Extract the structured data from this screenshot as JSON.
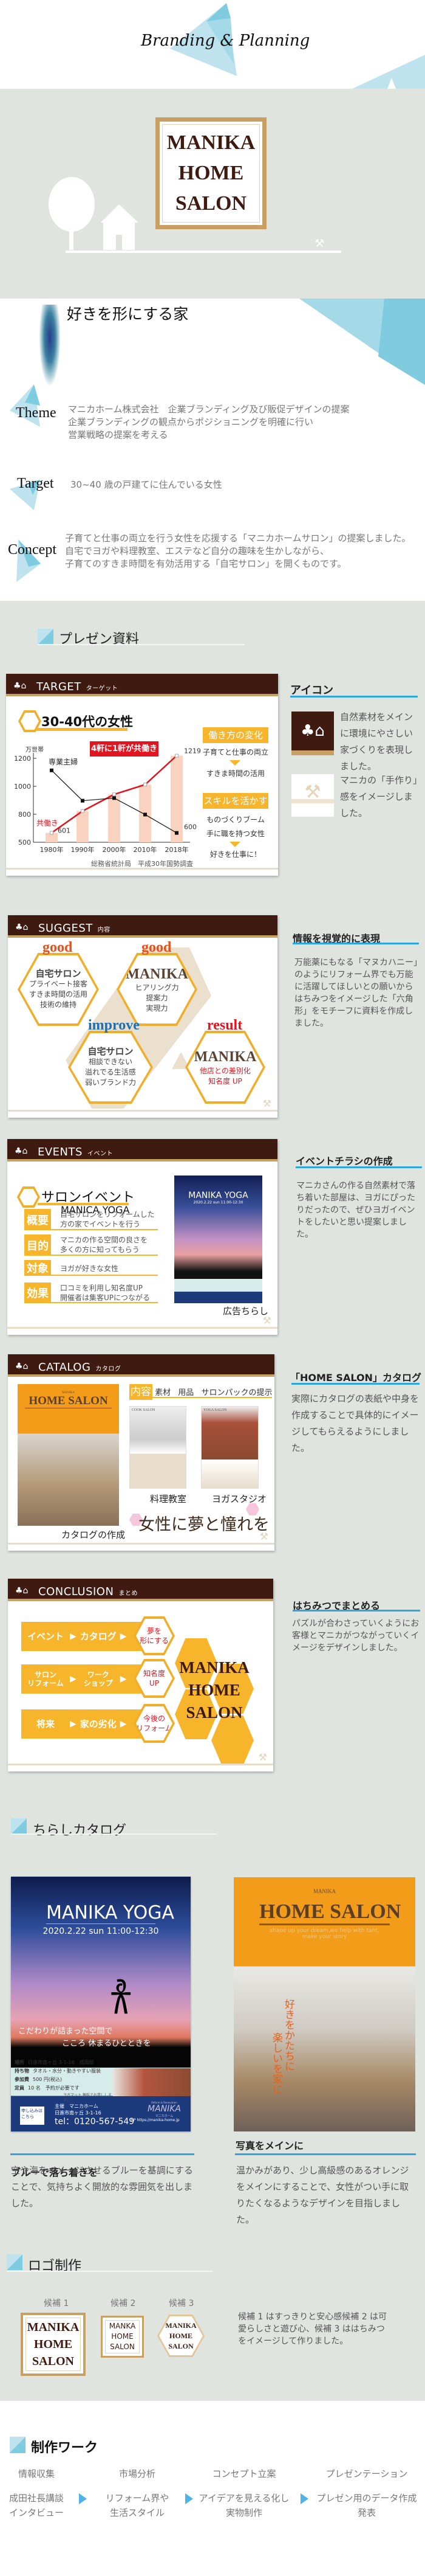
{
  "header": {
    "script_logo": "Branding & Planning"
  },
  "hero": {
    "logo_lines": [
      "MANIKA",
      "HOME",
      "SALON"
    ]
  },
  "intro": {
    "title": "好きを形にする家",
    "theme": {
      "label": "Theme",
      "lines": [
        "マニカホーム株式会社　企業ブランディング及び販促デザインの提案",
        "企業ブランディングの観点からポジショニングを明確に行い",
        "営業戦略の提案を考える"
      ]
    },
    "target": {
      "label": "Target",
      "lines": [
        "30~40 歳の戸建てに住んでいる女性"
      ]
    },
    "concept": {
      "label": "Concept",
      "lines": [
        "子育てと仕事の両立を行う女性を応援する「マニカホームサロン」の提案しました。",
        "自宅でヨガや料理教室、エステなど自分の趣味を生かしながら、",
        "子育てのすきま時間を有効活用する「自宅サロン」を開くものです。"
      ]
    }
  },
  "presentation": {
    "heading": "プレゼン資料",
    "slides": [
      {
        "title": "TARGET",
        "sub": "ターゲット",
        "headline": "30-40代の女性",
        "badge": "4軒に1軒が共働き",
        "box1": "働き方の変化",
        "box1_lines": [
          "子育てと仕事の両立",
          "すきま時間の活用"
        ],
        "box2": "スキルを活かす",
        "box2_lines": [
          "ものづくりブーム",
          "手に職を持つ女性",
          "好きを仕事に！"
        ],
        "source": "総務省統計局　平成30年国勢調査"
      },
      {
        "title": "SUGGEST",
        "sub": "内容",
        "hexes": [
          {
            "tag": "good",
            "title": "自宅サロン",
            "lines": [
              "プライベート接客",
              "すきま時間の活用",
              "技術の維持"
            ]
          },
          {
            "tag": "good",
            "title": "MANIKA",
            "lines": [
              "ヒアリング力",
              "提案力",
              "実現力"
            ]
          },
          {
            "tag": "improve",
            "title": "自宅サロン",
            "lines": [
              "相談できない",
              "溢れでる生活感",
              "弱いブランド力"
            ]
          },
          {
            "tag": "result",
            "title": "MANIKA",
            "lines": [
              "他店との差別化",
              "知名度 UP"
            ]
          }
        ]
      },
      {
        "title": "EVENTS",
        "sub": "イベント",
        "headline": "サロンイベント",
        "subhead": "MANICA YOGA",
        "rows": [
          {
            "label": "概要",
            "text": [
              "自宅サロンをリフォームした",
              "方の家でイベントを行う"
            ]
          },
          {
            "label": "目的",
            "text": [
              "マニカの作る空間の良さを",
              "多くの方に知ってもらう"
            ]
          },
          {
            "label": "対象",
            "text": [
              "ヨガが好きな女性"
            ]
          },
          {
            "label": "効果",
            "text": [
              "口コミを利用し知名度UP",
              "開催者は集客UPにつながる"
            ]
          }
        ],
        "poster_title": "MANIKA YOGA",
        "poster_date": "2020.2.22 sun  11:00-12:30",
        "poster_caption": "広告ちらし"
      },
      {
        "title": "CATALOG",
        "sub": "カタログ",
        "cover_brand": "MANIKA",
        "cover_title": "HOME SALON",
        "tabs": [
          "内容",
          "素材",
          "用品",
          "サロンパックの提示"
        ],
        "cook_label": "COOK SALON",
        "yoga_label": "YOGA SALON",
        "cook": "料理教室",
        "yoga": "ヨガスタジオ",
        "cover_caption": "カタログの作成",
        "slogan": "女性に夢と憧れを"
      },
      {
        "title": "CONCLUSION",
        "sub": "まとめ",
        "bars": [
          {
            "a": "イベント",
            "b": "カタログ",
            "hex": [
              "夢を",
              "形にする"
            ]
          },
          {
            "a": "サロン\nリフォーム",
            "b": "ワーク\nショップ",
            "hex": [
              "知名度",
              "UP"
            ]
          },
          {
            "a": "将来",
            "b": "家の劣化",
            "hex": [
              "今後の",
              "リフォーム"
            ]
          }
        ],
        "logo_lines": [
          "MANIKA",
          "HOME",
          "SALON"
        ]
      }
    ],
    "notes": [
      {
        "heading": "アイコン",
        "items": [
          {
            "icon": "tree-house-icon",
            "text": "自然素材をメインに環境にやさしい家づくりを表現しました。"
          },
          {
            "icon": "tools-icon",
            "text": "マニカの「手作り」感をイメージしました。"
          }
        ]
      },
      {
        "heading": "情報を視覚的に表現",
        "text": "万能薬にもなる「マヌカハニー」のようにリフォーム界でも万能に活躍してほしいとの願いからはちみつをイメージした「六角形」をモチーフに資料を作成しました。"
      },
      {
        "heading": "イベントチラシの作成",
        "text": "マニカさんの作る自然素材で落ち着いた部屋は、ヨガにぴったりだったので、ぜひヨガイベントをしたいと思い提案しました。"
      },
      {
        "heading": "「HOME SALON」カタログ",
        "text": "実際にカタログの表紙や中身を作成することで具体的にイメージしてもらえるようにしました。"
      },
      {
        "heading": "はちみつでまとめる",
        "text": "パズルが合わさっていくようにお客様とマニカがつながっていくイメージをデザインしました。"
      }
    ]
  },
  "chart_data": {
    "type": "bar+line",
    "title": "30-40代の女性",
    "ylabel": "万世帯",
    "categories": [
      "1980年",
      "1990年",
      "2000年",
      "2010年",
      "2018年"
    ],
    "yticks": [
      500,
      800,
      1000,
      1200
    ],
    "ylim": [
      500,
      1200
    ],
    "series": [
      {
        "name": "共働き",
        "type": "bar+line",
        "color": "#e0151f",
        "values": [
          601,
          823,
          942,
          1012,
          1219
        ]
      },
      {
        "name": "専業主婦",
        "type": "line",
        "color": "#111111",
        "values": [
          1114,
          897,
          916,
          797,
          600
        ]
      }
    ],
    "data_labels": {
      "共働き": {
        "0": "601",
        "4": "1219"
      },
      "専業主婦": {
        "4": "600"
      }
    },
    "source": "総務省統計局　平成30年国勢調査"
  },
  "flyers": {
    "heading": "ちらしカタログ",
    "yoga": {
      "title": "MANIKA YOGA",
      "date": "2020.2.22 sun  11:00-12:30",
      "tagline": [
        "こだわりが詰まった空間で",
        "こころ 休まるひとときを"
      ],
      "info": [
        {
          "k": "場所",
          "v": "日進市南ヶ丘 3-1-16　成田邸"
        },
        {
          "k": "持ち物",
          "v": "タオル・水分・動きやすい服装"
        },
        {
          "k": "参加費",
          "v": "500 円(税込)"
        },
        {
          "k": "定員",
          "v": "10 名　予約が必要です"
        }
      ],
      "mat_note": "ヨガマット 無料でお貸しします♪",
      "apply": "申し込みはこちら",
      "host": "主催　マニカホーム",
      "address": "日進市南ヶ丘 3-1-16",
      "tel": "tel：0120-567-549",
      "hp": "HP https://manika-home.jp",
      "brand_small": "Reform & Renovation",
      "brand": "MANIKA",
      "brand_jp": "マニカホーム",
      "caption": "ブルーで落ち着きを",
      "text": "空や海をイメージさせるブルーを基調にすることで、気持ちよく開放的な雰囲気を出しました。"
    },
    "salon": {
      "brand": "MANIKA",
      "title": "HOME SALON",
      "tag": [
        "shape up your dream,we help with taht,",
        "make your story"
      ],
      "vertical": [
        "好きをかたちに",
        "楽しいを家に"
      ],
      "caption": "写真をメインに",
      "text": "温かみがあり、少し高級感のあるオレンジをメインにすることで、女性がつい手に取りたくなるようなデザインを目指しました。"
    }
  },
  "logos": {
    "heading": "ロゴ制作",
    "candidates": [
      {
        "label": "候補 1",
        "lines": [
          "MANIKA",
          "HOME",
          "SALON"
        ]
      },
      {
        "label": "候補 2",
        "lines": [
          "MANKA",
          "HOME",
          "SALON"
        ]
      },
      {
        "label": "候補 3",
        "lines": [
          "MANIKA",
          "HOME",
          "SALON"
        ]
      }
    ],
    "text": "候補 1 はすっきりと安心感候補 2 は可愛らしさと遊び心、候補 3 ははちみつをイメージして作りました。"
  },
  "work": {
    "heading": "制作ワーク",
    "steps": [
      {
        "title": "情報収集",
        "lines": [
          "成田社長講談",
          "インタビュー"
        ]
      },
      {
        "title": "市場分析",
        "lines": [
          "リフォーム界や",
          "生活スタイル"
        ]
      },
      {
        "title": "コンセプト立案",
        "lines": [
          "アイデアを見える化し",
          "実物制作"
        ]
      },
      {
        "title": "プレゼンテーション",
        "lines": [
          "プレゼン用のデータ作成",
          "発表"
        ]
      }
    ]
  },
  "colors": {
    "bg_gray": "#dfe4df",
    "brown": "#3e1a10",
    "tan": "#c9a063",
    "honey": "#f7b52c",
    "accent_blue": "#2ea7e0",
    "red": "#e0151f"
  }
}
